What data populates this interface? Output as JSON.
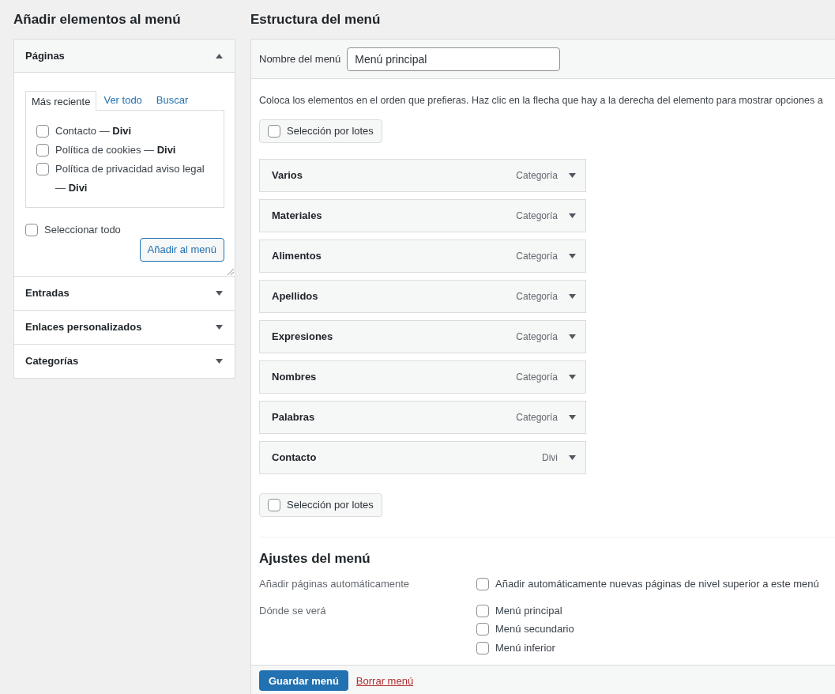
{
  "left_title": "Añadir elementos al menú",
  "sections": [
    {
      "title": "Páginas",
      "expanded": true,
      "tabs": [
        {
          "label": "Más reciente",
          "selected": true
        },
        {
          "label": "Ver todo",
          "selected": false
        },
        {
          "label": "Buscar",
          "selected": false
        }
      ],
      "items": [
        {
          "label": "Contacto — ",
          "suffix": "Divi",
          "checked": false
        },
        {
          "label": "Política de cookies — ",
          "suffix": "Divi",
          "checked": false
        },
        {
          "label": "Política de privacidad aviso legal — ",
          "suffix": "Divi",
          "checked": false
        }
      ],
      "select_all": {
        "label": "Seleccionar todo",
        "checked": false
      },
      "button": "Añadir al menú"
    },
    {
      "title": "Entradas",
      "expanded": false
    },
    {
      "title": "Enlaces personalizados",
      "expanded": false
    },
    {
      "title": "Categorías",
      "expanded": false
    }
  ],
  "right_title": "Estructura del menú",
  "menu_name": {
    "label": "Nombre del menú",
    "value": "Menú principal"
  },
  "instructions": "Coloca los elementos en el orden que prefieras. Haz clic en la flecha que hay a la derecha del elemento para mostrar opciones a",
  "bulk_top": {
    "label": "Selección por lotes",
    "checked": false
  },
  "menu_items": [
    {
      "title": "Varios",
      "type": "Categoría"
    },
    {
      "title": "Materiales",
      "type": "Categoría"
    },
    {
      "title": "Alimentos",
      "type": "Categoría"
    },
    {
      "title": "Apellidos",
      "type": "Categoría"
    },
    {
      "title": "Expresiones",
      "type": "Categoría"
    },
    {
      "title": "Nombres",
      "type": "Categoría"
    },
    {
      "title": "Palabras",
      "type": "Categoría"
    },
    {
      "title": "Contacto",
      "type": "Divi"
    }
  ],
  "bulk_bottom": {
    "label": "Selección por lotes",
    "checked": false
  },
  "settings": {
    "title": "Ajustes del menú",
    "auto_add": {
      "label": "Añadir páginas automáticamente",
      "option": "Añadir automáticamente nuevas páginas de nivel superior a este menú",
      "checked": false
    },
    "locations": {
      "label": "Dónde se verá",
      "options": [
        {
          "label": "Menú principal",
          "checked": false
        },
        {
          "label": "Menú secundario",
          "checked": false
        },
        {
          "label": "Menú inferior",
          "checked": false
        }
      ]
    }
  },
  "save_button": "Guardar menú",
  "delete_link": "Borrar menú"
}
